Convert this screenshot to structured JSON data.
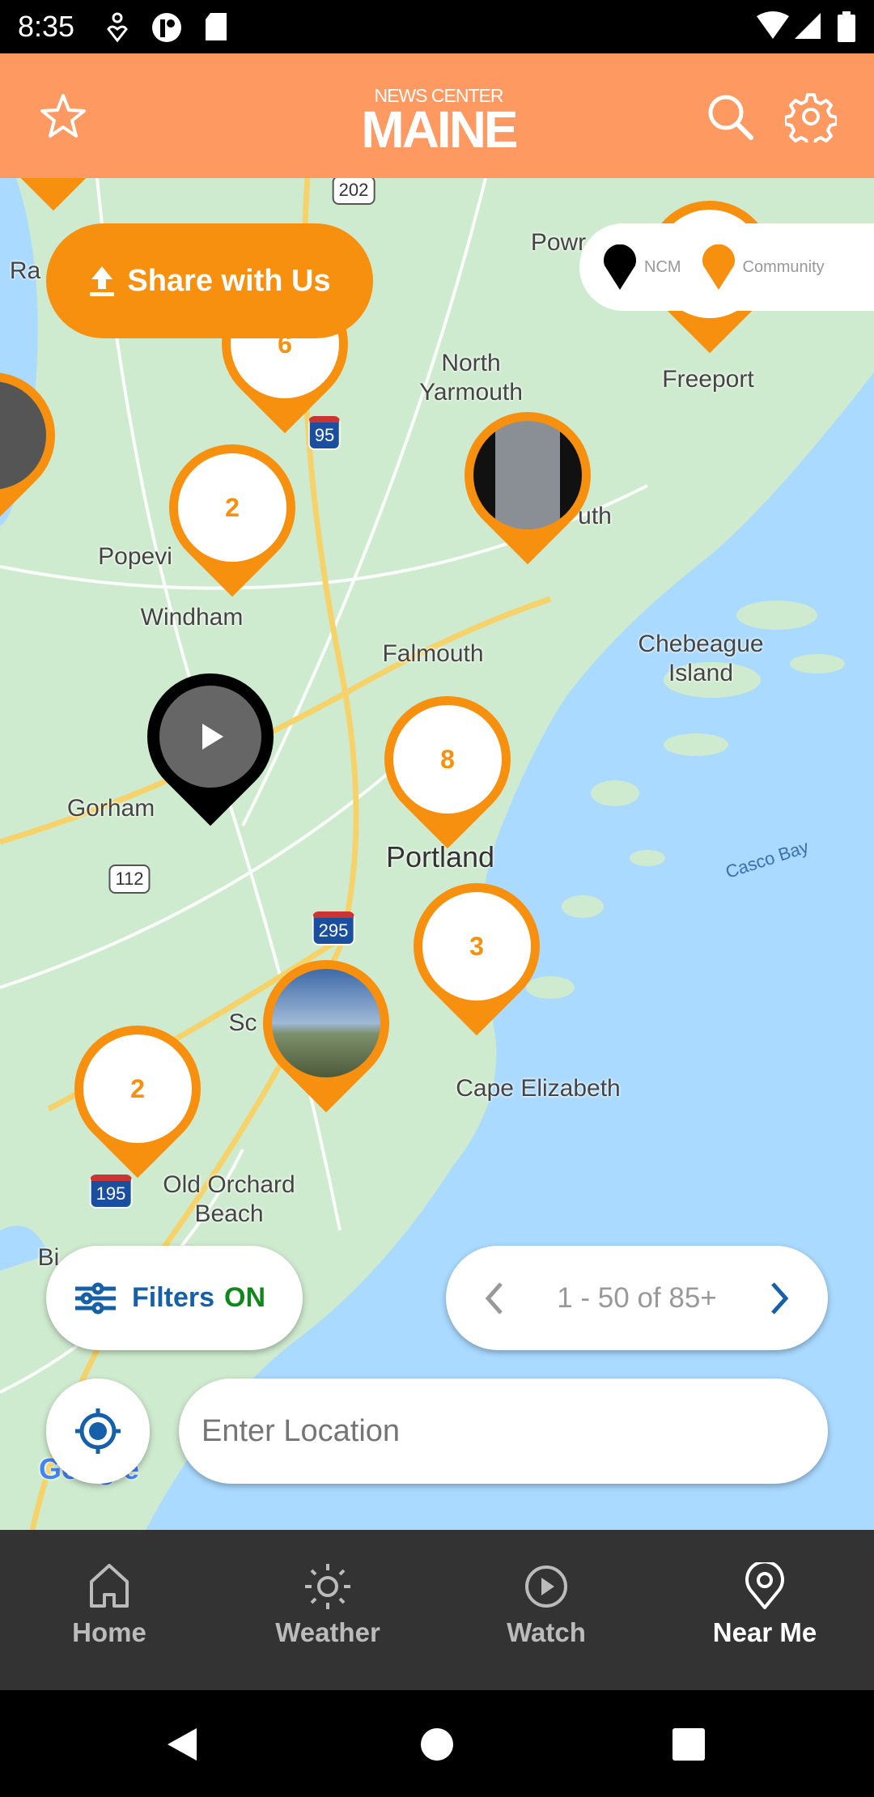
{
  "status_bar": {
    "time": "8:35"
  },
  "header": {
    "logo_top": "NEWS CENTER",
    "logo_main": "MAINE",
    "icons": [
      "star-icon",
      "search-icon",
      "gear-icon"
    ]
  },
  "share_button": {
    "label": "Share with Us",
    "icon": "upload-icon"
  },
  "legend": {
    "ncm": "NCM",
    "community": "Community"
  },
  "map": {
    "labels": {
      "pownal": "Powr",
      "ra": "Ra",
      "north_yarmouth": "North\nYarmouth",
      "freeport": "Freeport",
      "popeville": "Popevi",
      "yarmouth": "uth",
      "windham": "Windham",
      "falmouth": "Falmouth",
      "chebeague": "Chebeague\nIsland",
      "gorham": "Gorham",
      "portland": "Portland",
      "casco_bay": "Casco Bay",
      "sc": "Sc",
      "cape_elizabeth": "Cape Elizabeth",
      "old_orchard": "Old Orchard\nBeach",
      "bi": "Bi",
      "google": "Google"
    },
    "shields": {
      "r202": "202",
      "i95": "95",
      "r112": "112",
      "i295": "295",
      "i195": "195"
    },
    "markers": {
      "c6": "6",
      "c2a": "2",
      "c8": "8",
      "c3": "3",
      "c2b": "2"
    }
  },
  "filters": {
    "label": "Filters",
    "state": "ON"
  },
  "pager": {
    "text": "1 - 50 of 85+"
  },
  "location_input": {
    "placeholder": "Enter Location",
    "value": ""
  },
  "nav": {
    "items": [
      {
        "label": "Home",
        "icon": "home-icon"
      },
      {
        "label": "Weather",
        "icon": "sun-icon"
      },
      {
        "label": "Watch",
        "icon": "play-circle-icon"
      },
      {
        "label": "Near Me",
        "icon": "location-pin-icon",
        "active": true
      }
    ]
  },
  "colors": {
    "header": "#FE9961",
    "accent": "#F7900F",
    "filters_blue": "#1560A8",
    "filters_on": "#11871B",
    "nav_bg": "#333333"
  }
}
